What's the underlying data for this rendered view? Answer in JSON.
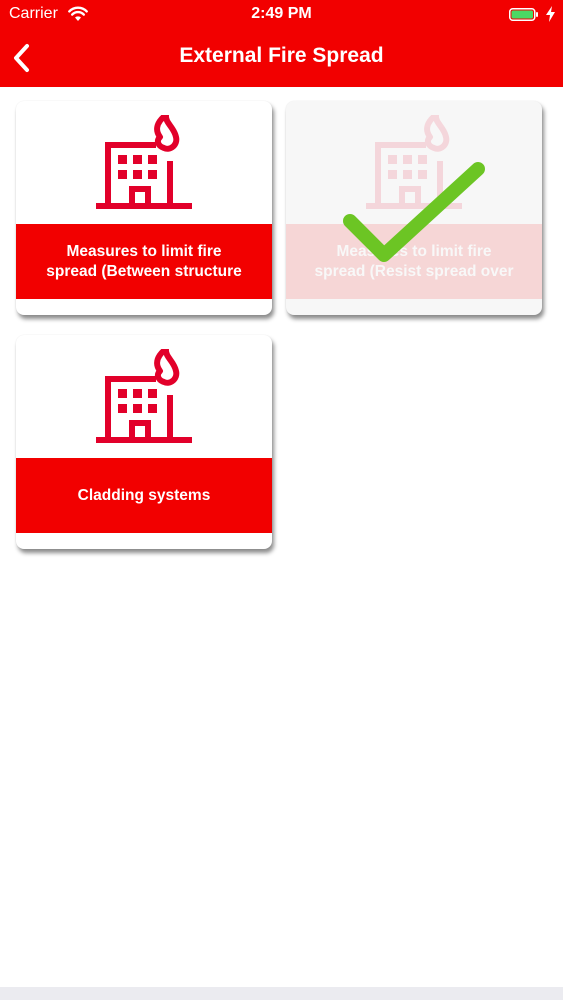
{
  "status_bar": {
    "carrier": "Carrier",
    "time": "2:49 PM",
    "wifi_icon": "wifi-icon",
    "battery_icon": "battery-icon",
    "charging_icon": "bolt-icon",
    "battery_color": "#4cd964"
  },
  "nav": {
    "title": "External Fire Spread",
    "back_icon": "chevron-left-icon"
  },
  "colors": {
    "brand_red": "#f20000",
    "check_green": "#6cc524"
  },
  "tiles": [
    {
      "label": "Measures to limit fire\nspread (Between structure",
      "icon": "building-fire-icon",
      "completed": false
    },
    {
      "label": "Measures to limit fire\nspread (Resist spread over",
      "icon": "building-fire-icon",
      "completed": true,
      "status_icon": "checkmark-icon"
    },
    {
      "label": "Cladding systems",
      "icon": "building-fire-icon",
      "completed": false
    }
  ]
}
